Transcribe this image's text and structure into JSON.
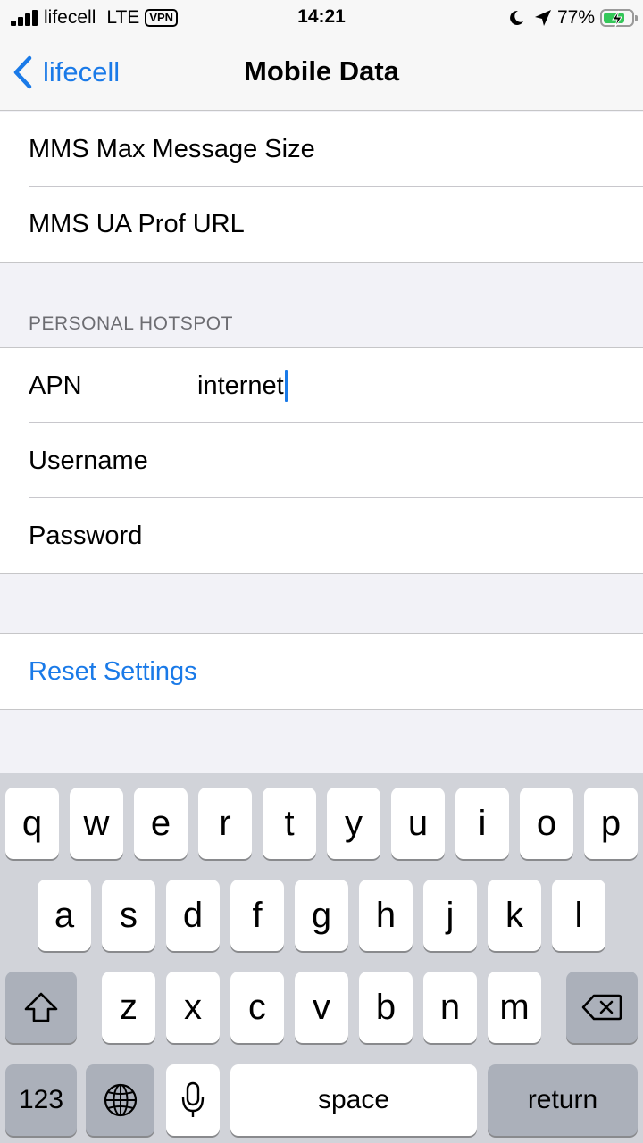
{
  "status_bar": {
    "carrier": "lifecell",
    "network": "LTE",
    "vpn": "VPN",
    "time": "14:21",
    "battery_percent": "77%",
    "battery_level": 0.77,
    "icons": [
      "signal-bars-icon",
      "moon-icon",
      "location-arrow-icon",
      "battery-charging-icon"
    ]
  },
  "nav": {
    "back_label": "lifecell",
    "title": "Mobile Data"
  },
  "mms_group": {
    "rows": [
      {
        "label": "MMS Max Message Size"
      },
      {
        "label": "MMS UA Prof URL"
      }
    ]
  },
  "hotspot": {
    "header": "PERSONAL HOTSPOT",
    "rows": [
      {
        "label": "APN",
        "value": "internet"
      },
      {
        "label": "Username",
        "value": ""
      },
      {
        "label": "Password",
        "value": ""
      }
    ]
  },
  "reset": {
    "label": "Reset Settings"
  },
  "keyboard": {
    "row1": [
      "q",
      "w",
      "e",
      "r",
      "t",
      "y",
      "u",
      "i",
      "o",
      "p"
    ],
    "row2": [
      "a",
      "s",
      "d",
      "f",
      "g",
      "h",
      "j",
      "k",
      "l"
    ],
    "row3": [
      "z",
      "x",
      "c",
      "v",
      "b",
      "n",
      "m"
    ],
    "numbers_label": "123",
    "space_label": "space",
    "return_label": "return"
  },
  "colors": {
    "accent": "#1a7ae8",
    "battery": "#34c759"
  }
}
